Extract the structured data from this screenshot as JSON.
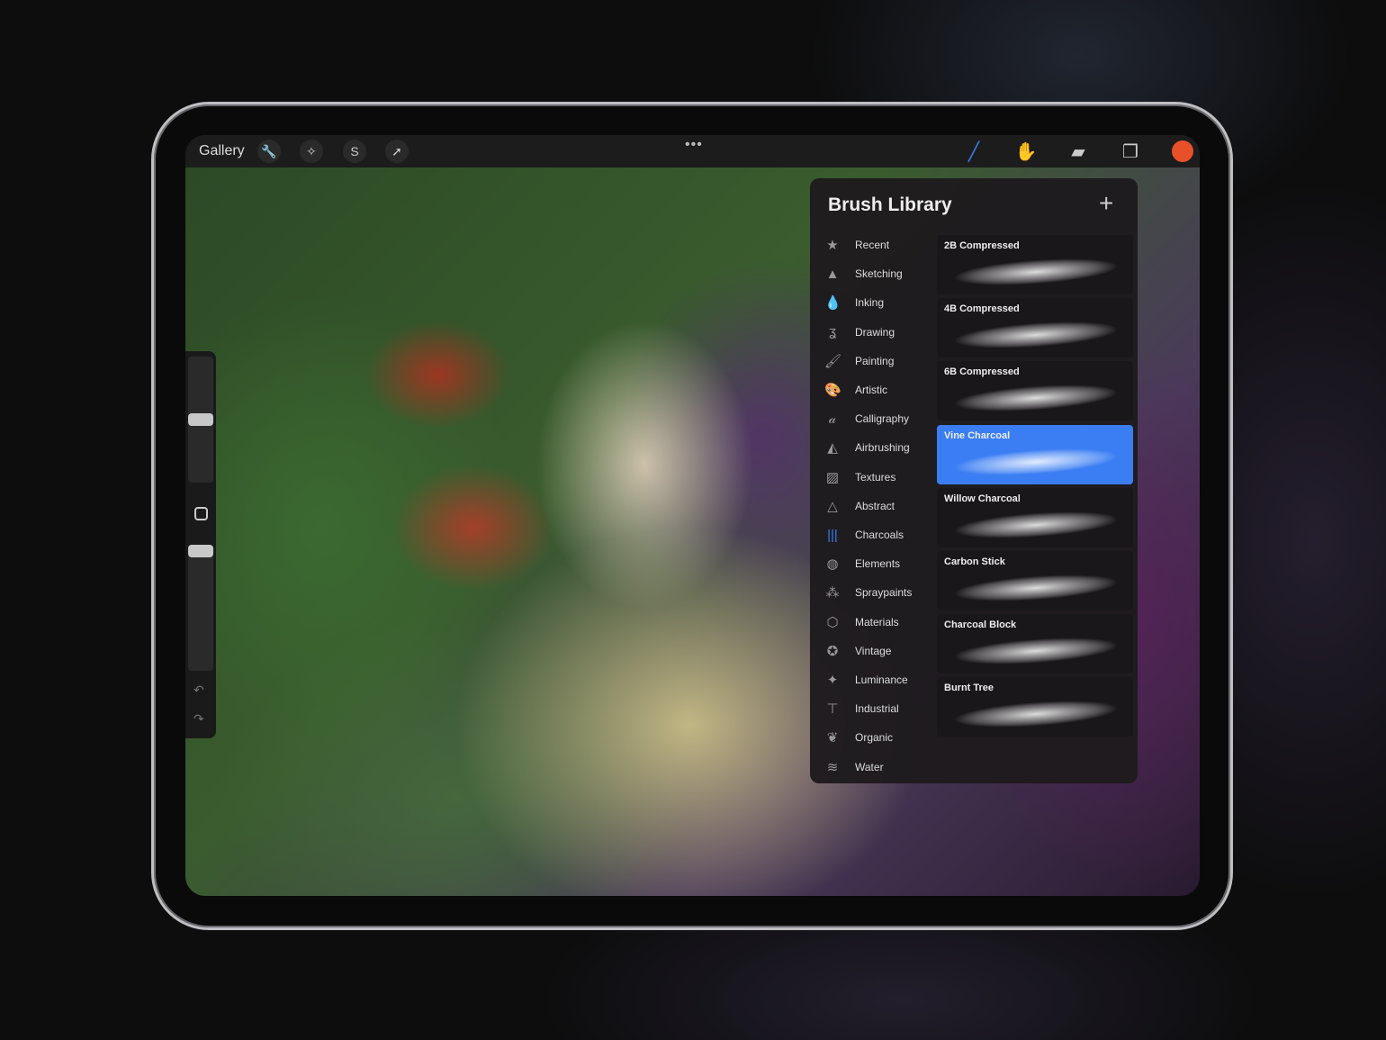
{
  "toolbar": {
    "gallery": "Gallery",
    "left_icons": [
      "wrench-icon",
      "magic-wand-icon",
      "selection-icon",
      "transform-arrow-icon"
    ],
    "more": "•••",
    "right_icons": [
      "brush-icon",
      "smudge-icon",
      "eraser-icon",
      "layers-icon"
    ],
    "current_color": "#e8502a",
    "accent": "#3b7ef3"
  },
  "sidebar": {
    "brush_size_percent": 50,
    "opacity_percent": 95
  },
  "brush_library": {
    "title": "Brush Library",
    "add": "+",
    "categories": [
      {
        "label": "Recent",
        "icon": "★"
      },
      {
        "label": "Sketching",
        "icon": "▲"
      },
      {
        "label": "Inking",
        "icon": "💧"
      },
      {
        "label": "Drawing",
        "icon": "ʓ"
      },
      {
        "label": "Painting",
        "icon": "🖌"
      },
      {
        "label": "Artistic",
        "icon": "🎨"
      },
      {
        "label": "Calligraphy",
        "icon": "𝒶"
      },
      {
        "label": "Airbrushing",
        "icon": "◭"
      },
      {
        "label": "Textures",
        "icon": "▨"
      },
      {
        "label": "Abstract",
        "icon": "△"
      },
      {
        "label": "Charcoals",
        "icon": "|||"
      },
      {
        "label": "Elements",
        "icon": "◍"
      },
      {
        "label": "Spraypaints",
        "icon": "⁂"
      },
      {
        "label": "Materials",
        "icon": "⬡"
      },
      {
        "label": "Vintage",
        "icon": "✪"
      },
      {
        "label": "Luminance",
        "icon": "✦"
      },
      {
        "label": "Industrial",
        "icon": "⊤"
      },
      {
        "label": "Organic",
        "icon": "❦"
      },
      {
        "label": "Water",
        "icon": "≋"
      }
    ],
    "active_category": "Charcoals",
    "brushes": [
      "2B Compressed",
      "4B Compressed",
      "6B Compressed",
      "Vine Charcoal",
      "Willow Charcoal",
      "Carbon Stick",
      "Charcoal Block",
      "Burnt Tree"
    ],
    "selected_brush": "Vine Charcoal"
  }
}
